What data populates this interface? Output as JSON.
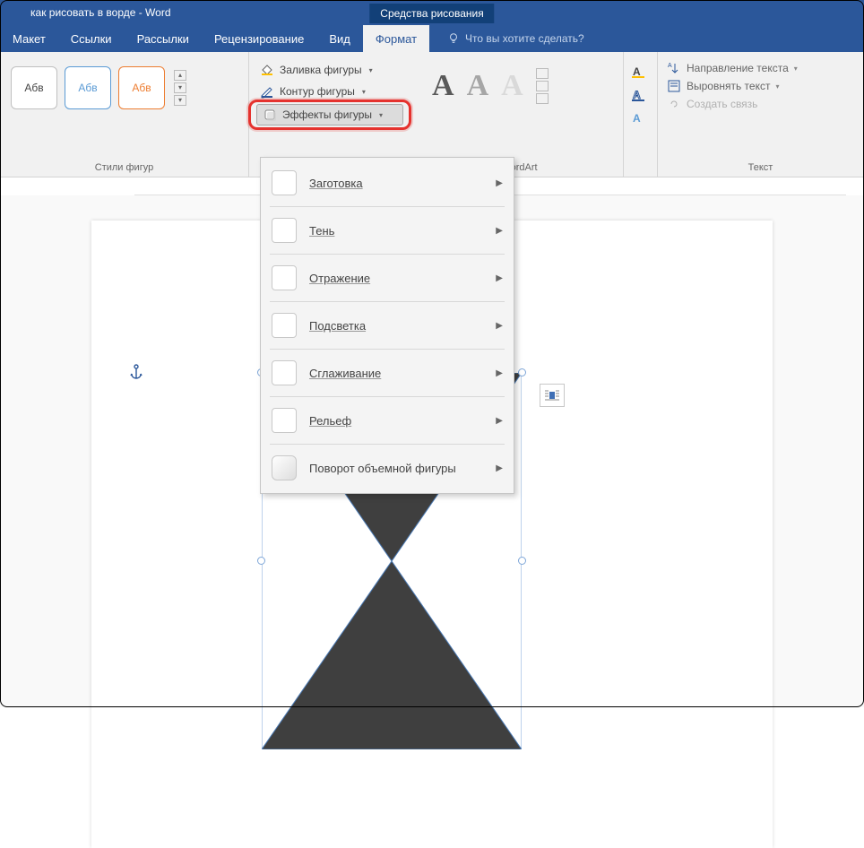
{
  "titlebar": {
    "doc_title": "как рисовать в ворде - Word",
    "tool_context": "Средства рисования"
  },
  "tabs": {
    "layout": "Макет",
    "references": "Ссылки",
    "mailings": "Рассылки",
    "review": "Рецензирование",
    "view": "Вид",
    "format": "Формат",
    "tell_me": "Что вы хотите сделать?"
  },
  "ribbon": {
    "styles": {
      "sample_text": "Абв",
      "group_label": "Стили фигур"
    },
    "shape_tools": {
      "fill": "Заливка фигуры",
      "outline": "Контур фигуры",
      "effects": "Эффекты фигуры"
    },
    "wordart": {
      "glyph": "A",
      "group_label": "WordArt"
    },
    "text": {
      "direction": "Направление текста",
      "align": "Выровнять текст",
      "link": "Создать связь",
      "group_label": "Текст"
    }
  },
  "effects_menu": {
    "items": [
      {
        "label": "Заготовка"
      },
      {
        "label": "Тень"
      },
      {
        "label": "Отражение"
      },
      {
        "label": "Подсветка"
      },
      {
        "label": "Сглаживание"
      },
      {
        "label": "Рельеф"
      },
      {
        "label": "Поворот объемной фигуры"
      }
    ]
  }
}
